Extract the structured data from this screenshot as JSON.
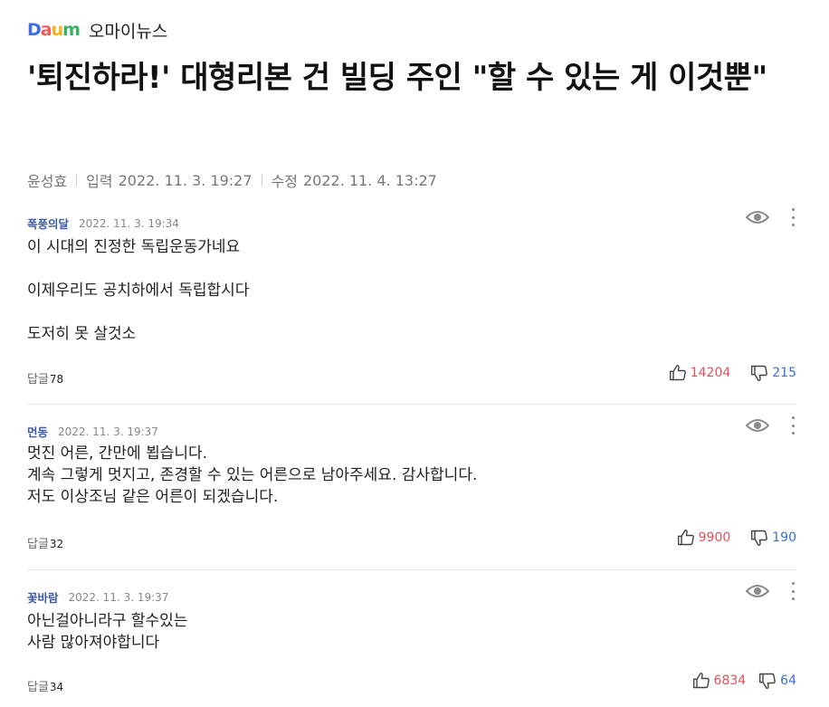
{
  "header": {
    "logo": {
      "d": "D",
      "a": "a",
      "u": "u",
      "m": "m"
    },
    "press": "오마이뉴스"
  },
  "article": {
    "title": "'퇴진하라!' 대형리본 건 빌딩 주인 \"할 수 있는 게 이것뿐\"",
    "author": "윤성효",
    "input_label": "입력",
    "input_date": "2022. 11. 3. 19:27",
    "edit_label": "수정",
    "edit_date": "2022. 11. 4. 13:27"
  },
  "reply_label": "답글",
  "comments": [
    {
      "name": "폭풍의달",
      "date": "2022. 11. 3. 19:34",
      "text": "이 시대의 진정한 독립운동가네요\n\n이제우리도 공치하에서 독립합시다\n\n도저히 못 살것소",
      "replies": "78",
      "likes": "14204",
      "dislikes": "215"
    },
    {
      "name": "먼동",
      "date": "2022. 11. 3. 19:37",
      "text": "멋진 어른, 간만에 뵙습니다.\n계속 그렇게 멋지고, 존경할 수 있는 어른으로 남아주세요. 감사합니다.\n저도 이상조님 같은 어른이 되겠습니다.",
      "replies": "32",
      "likes": "9900",
      "dislikes": "190"
    },
    {
      "name": "꽃바람",
      "date": "2022. 11. 3. 19:37",
      "text": "아닌걸아니라구  할수있는\n사람 많아져야합니다",
      "replies": "34",
      "likes": "6834",
      "dislikes": "64"
    }
  ],
  "colors": {
    "author": "#3c5aa6",
    "like": "#e0505a",
    "dislike": "#3c6fd1"
  }
}
